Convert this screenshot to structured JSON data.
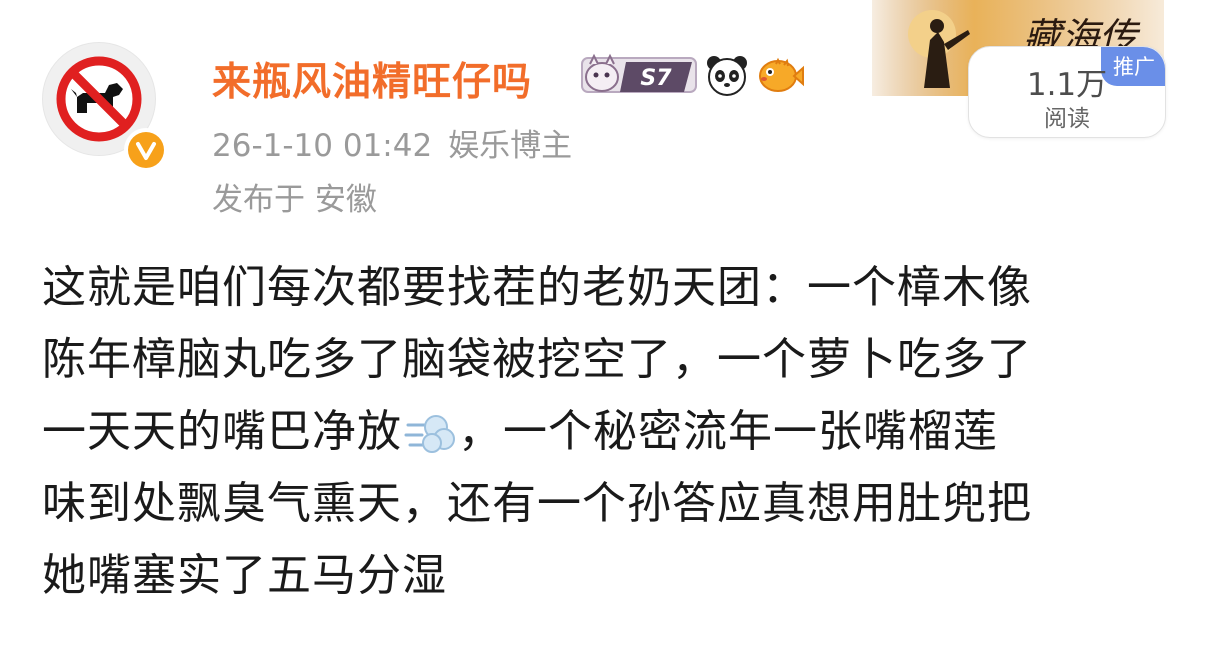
{
  "post": {
    "username": "来瓶风油精旺仔吗",
    "timestamp": "26-1-10 01:42",
    "category": "娱乐博主",
    "location": "发布于 安徽",
    "badges": [
      "bunny-badge",
      "s7-badge",
      "panda-icon",
      "pufferfish-icon"
    ],
    "badge_text": "S7",
    "ad": {
      "banner_title": "藏海传",
      "tag": "推广",
      "read_count": "1.1万",
      "read_label": "阅读"
    },
    "body": {
      "line1": "这就是咱们每次都要找茬的老奶天团：一个樟木像",
      "line2": "陈年樟脑丸吃多了脑袋被挖空了，一个萝卜吃多了",
      "line3_before": "一天天的嘴巴净放",
      "line3_after": "，一个秘密流年一张嘴榴莲",
      "line4": "味到处飘臭气熏天，还有一个孙答应真想用肚兜把",
      "line5": "她嘴塞实了五马分湿"
    }
  },
  "colors": {
    "username": "#f26d2a",
    "meta": "#9a9a9a",
    "verified": "#f7a11a",
    "ad_tag": "#6a8fe8",
    "body_text": "#1a1a1a"
  }
}
